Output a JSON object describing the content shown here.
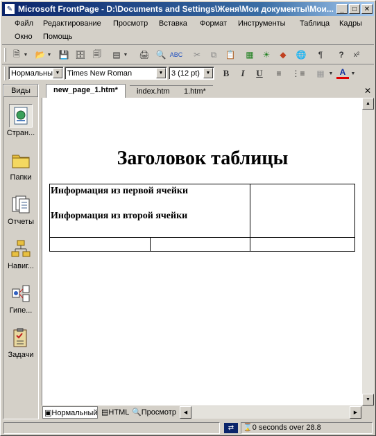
{
  "window": {
    "title": "Microsoft FrontPage - D:\\Documents and Settings\\Женя\\Мои документы\\Мои..."
  },
  "menu": {
    "items_row1": [
      "Файл",
      "Редактирование",
      "Просмотр",
      "Вставка",
      "Формат",
      "Инструменты",
      "Таблица",
      "Кадры"
    ],
    "items_row2": [
      "Окно",
      "Помощь"
    ]
  },
  "format_toolbar": {
    "style": "Нормальный",
    "font": "Times New Roman",
    "size": "3  (12 pt)"
  },
  "views": {
    "header": "Виды",
    "items": [
      "Стран...",
      "Папки",
      "Отчеты",
      "Навиг...",
      "Гипе...",
      "Задачи"
    ]
  },
  "tabs": [
    "new_page_1.htm*",
    "index.htm",
    "1.htm*"
  ],
  "document": {
    "heading": "Заголовок таблицы",
    "cell1_line1": "Информация из первой ячейки",
    "cell1_line2": "Информация из второй ячейки"
  },
  "view_tabs": [
    "Нормальный",
    "HTML",
    "Просмотр"
  ],
  "status": {
    "text": "0 seconds over 28.8"
  }
}
